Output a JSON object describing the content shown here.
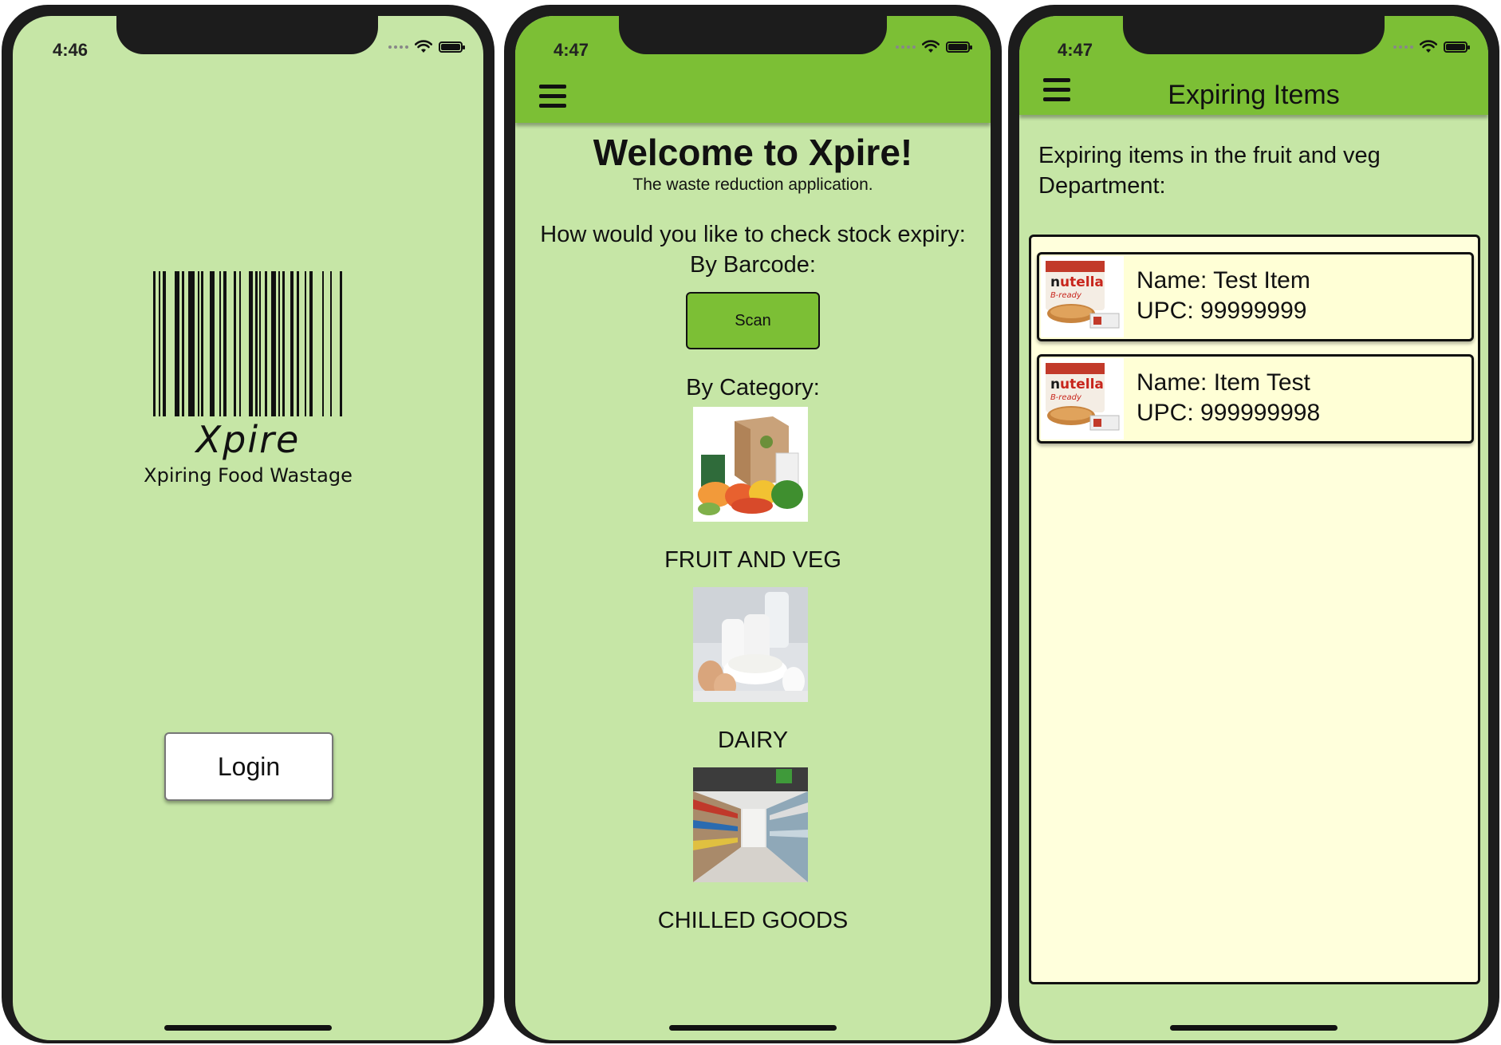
{
  "screens": [
    {
      "status": {
        "time": "4:46"
      },
      "logo": {
        "word": "Xpire",
        "tagline": "Xpiring Food Wastage"
      },
      "login_label": "Login"
    },
    {
      "status": {
        "time": "4:47"
      },
      "welcome_title": "Welcome to Xpire!",
      "welcome_sub": "The waste reduction application.",
      "question": "How would you like to check stock expiry:",
      "by_barcode": "By Barcode:",
      "scan_label": "Scan",
      "by_category": "By Category:",
      "categories": [
        {
          "label": "FRUIT AND VEG",
          "image": "fruit-and-veg-box-image"
        },
        {
          "label": "DAIRY",
          "image": "dairy-products-image"
        },
        {
          "label": "CHILLED GOODS",
          "image": "supermarket-aisle-image"
        }
      ]
    },
    {
      "status": {
        "time": "4:47"
      },
      "title": "Expiring Items",
      "intro": "Expiring items in the fruit and veg Department:",
      "items": [
        {
          "name": "Name: Test Item",
          "upc": "UPC: 99999999",
          "image": "nutella-b-ready-image"
        },
        {
          "name": "Name: Item Test",
          "upc": "UPC: 999999998",
          "image": "nutella-b-ready-image"
        }
      ]
    }
  ],
  "colors": {
    "background": "#c6e6a6",
    "header": "#7cbf35",
    "list_background": "#ffffdc"
  }
}
